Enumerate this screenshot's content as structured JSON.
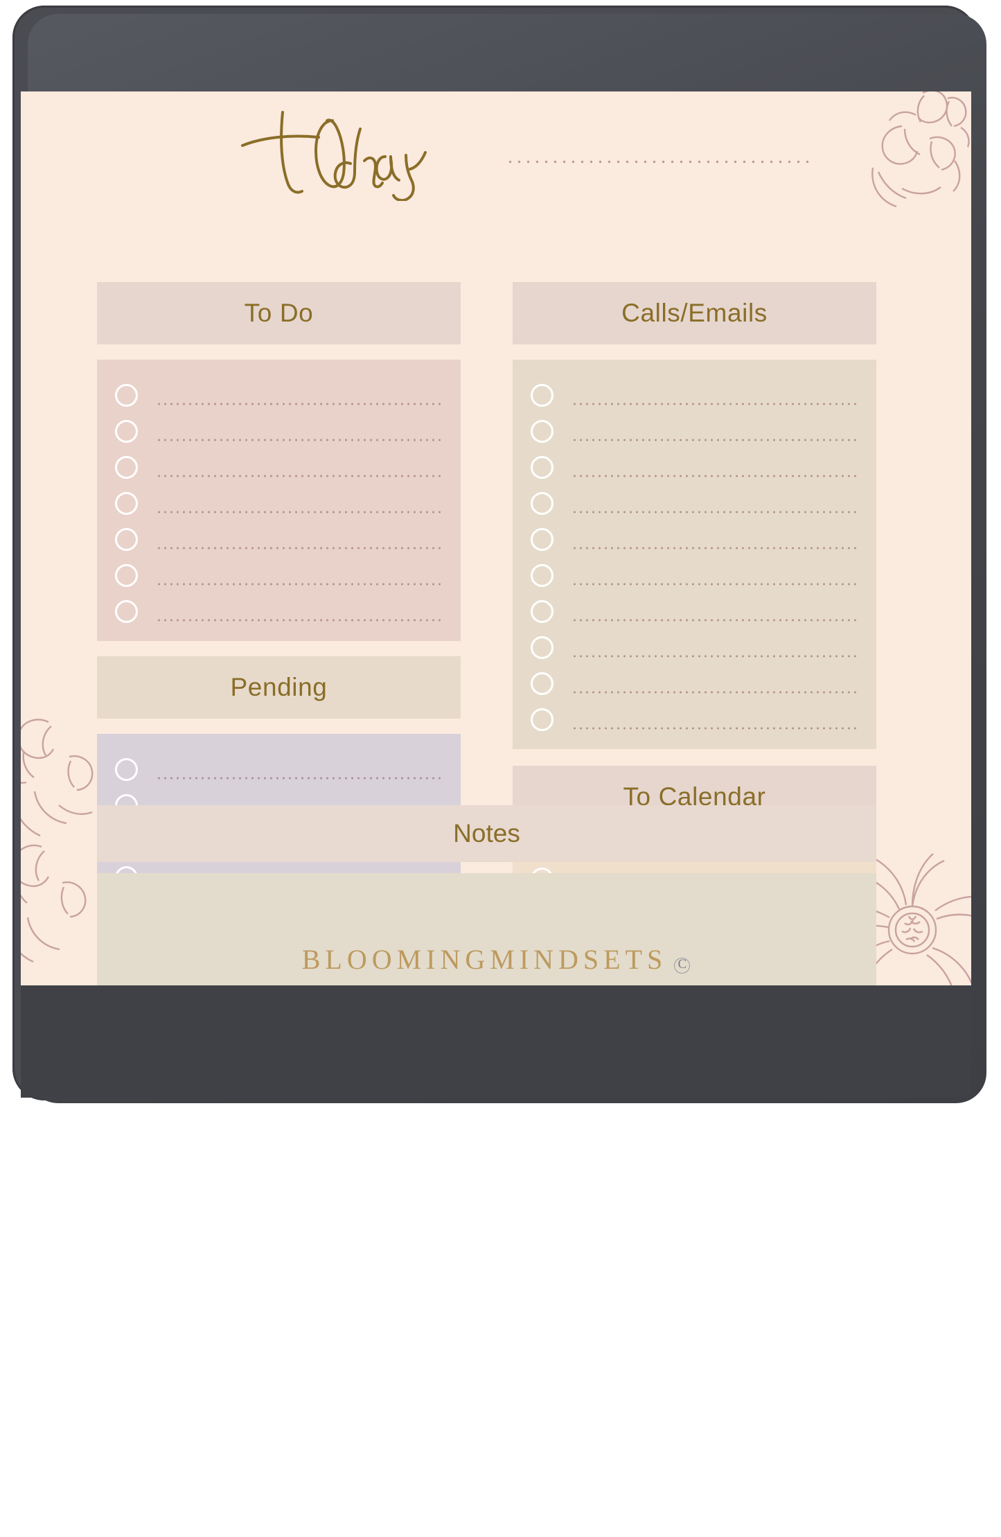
{
  "page": {
    "title_script": "Today",
    "brand": "BLOOMINGMINDSETS",
    "brand_mark": "C",
    "colors": {
      "page_bg": "#fbeade",
      "bezel": "#4a4c52",
      "header_rose": "#e7d7cf",
      "header_tan": "#e8dacb",
      "todo_box": "#e9d2c9",
      "pending_box": "#d9d1d9",
      "calls_box": "#e6dbcb",
      "calendar_box": "#f0dfcb",
      "notes_box": "#e3dccd",
      "heading_text": "#8a6e28",
      "brand_gold": "#bd9a5e",
      "floral_line": "#c8a2a0"
    }
  },
  "sections": {
    "todo": {
      "title": "To Do",
      "rows": 7
    },
    "pending": {
      "title": "Pending",
      "rows": 7
    },
    "calls": {
      "title": "Calls/Emails",
      "rows": 10
    },
    "calendar": {
      "title": "To Calendar",
      "rows": 4
    },
    "notes": {
      "title": "Notes",
      "rows": 0
    }
  }
}
